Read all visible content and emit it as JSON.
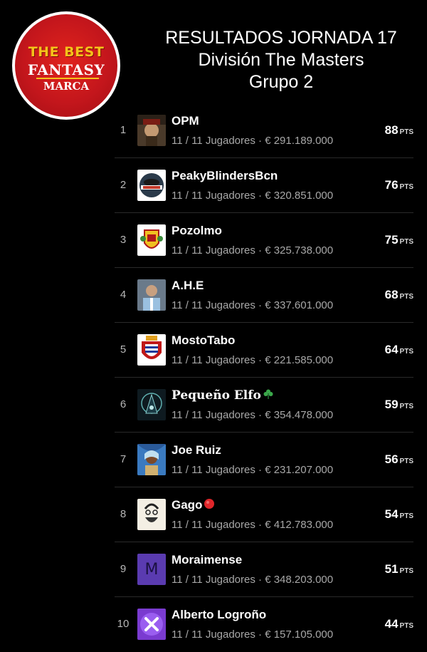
{
  "logo": {
    "line1": "THE BEST",
    "line2": "FANTASY",
    "line3": "MARCA"
  },
  "header": {
    "line1": "RESULTADOS JORNADA 17",
    "line2": "División The Masters",
    "line3": "Grupo 2"
  },
  "points_unit": "PTS",
  "colors": {
    "background": "#000000",
    "logo_red": "#c4161c",
    "logo_gold": "#f4c21a"
  },
  "rows": [
    {
      "rank": "1",
      "team": "OPM",
      "detail": "11 / 11 Jugadores · € 291.189.000",
      "points": "88",
      "avatar": "pirate-avatar-icon"
    },
    {
      "rank": "2",
      "team": "PeakyBlindersBcn",
      "detail": "11 / 11 Jugadores · € 320.851.000",
      "points": "76",
      "avatar": "peaky-blinders-avatar-icon"
    },
    {
      "rank": "3",
      "team": "Pozolmo",
      "detail": "11 / 11 Jugadores · € 325.738.000",
      "points": "75",
      "avatar": "coat-of-arms-avatar-icon"
    },
    {
      "rank": "4",
      "team": "A.H.E",
      "detail": "11 / 11 Jugadores · € 337.601.000",
      "points": "68",
      "avatar": "player-photo-avatar-icon"
    },
    {
      "rank": "5",
      "team": "MostoTabo",
      "detail": "11 / 11 Jugadores · € 221.585.000",
      "points": "64",
      "avatar": "shield-crest-avatar-icon"
    },
    {
      "rank": "6",
      "team": "Pequeño Elfo",
      "detail": "11 / 11 Jugadores · € 354.478.000",
      "points": "59",
      "avatar": "elf-avatar-icon",
      "emoji": "shamrock-icon"
    },
    {
      "rank": "7",
      "team": "Joe Ruiz",
      "detail": "11 / 11 Jugadores · € 231.207.000",
      "points": "56",
      "avatar": "painted-portrait-avatar-icon"
    },
    {
      "rank": "8",
      "team": "Gago",
      "detail": "11 / 11 Jugadores · € 412.783.000",
      "points": "54",
      "avatar": "sketch-face-avatar-icon",
      "emoji": "red-circle-icon"
    },
    {
      "rank": "9",
      "team": "Moraimense",
      "detail": "11 / 11 Jugadores · € 348.203.000",
      "points": "51",
      "avatar": "letter-m-avatar-icon",
      "avatar_letter": "M"
    },
    {
      "rank": "10",
      "team": "Alberto Logroño",
      "detail": "11 / 11 Jugadores · € 157.105.000",
      "points": "44",
      "avatar": "purple-x-avatar-icon"
    }
  ]
}
